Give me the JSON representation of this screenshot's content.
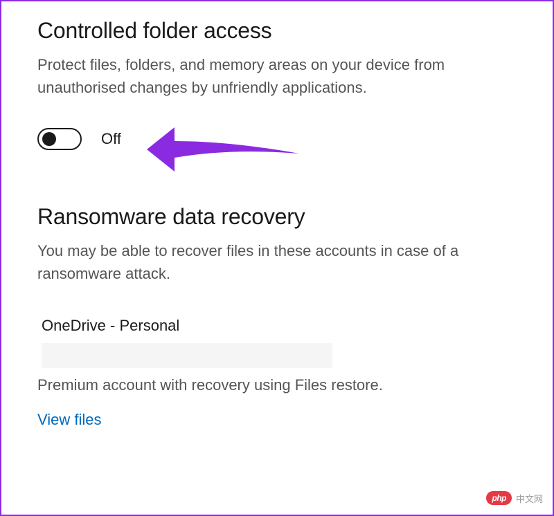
{
  "controlled_folder_access": {
    "heading": "Controlled folder access",
    "description": "Protect files, folders, and memory areas on your device from unauthorised changes by unfriendly applications.",
    "toggle_state": "Off"
  },
  "ransomware_recovery": {
    "heading": "Ransomware data recovery",
    "description": "You may be able to recover files in these accounts in case of a ransomware attack.",
    "account": {
      "name": "OneDrive - Personal",
      "detail": "Premium account with recovery using Files restore.",
      "link_label": "View files"
    }
  },
  "watermark": {
    "badge": "php",
    "text": "中文网"
  },
  "colors": {
    "border": "#8a2be2",
    "arrow": "#8a2be2",
    "link": "#0067b8",
    "text_primary": "#1a1a1a",
    "text_secondary": "#555555"
  }
}
